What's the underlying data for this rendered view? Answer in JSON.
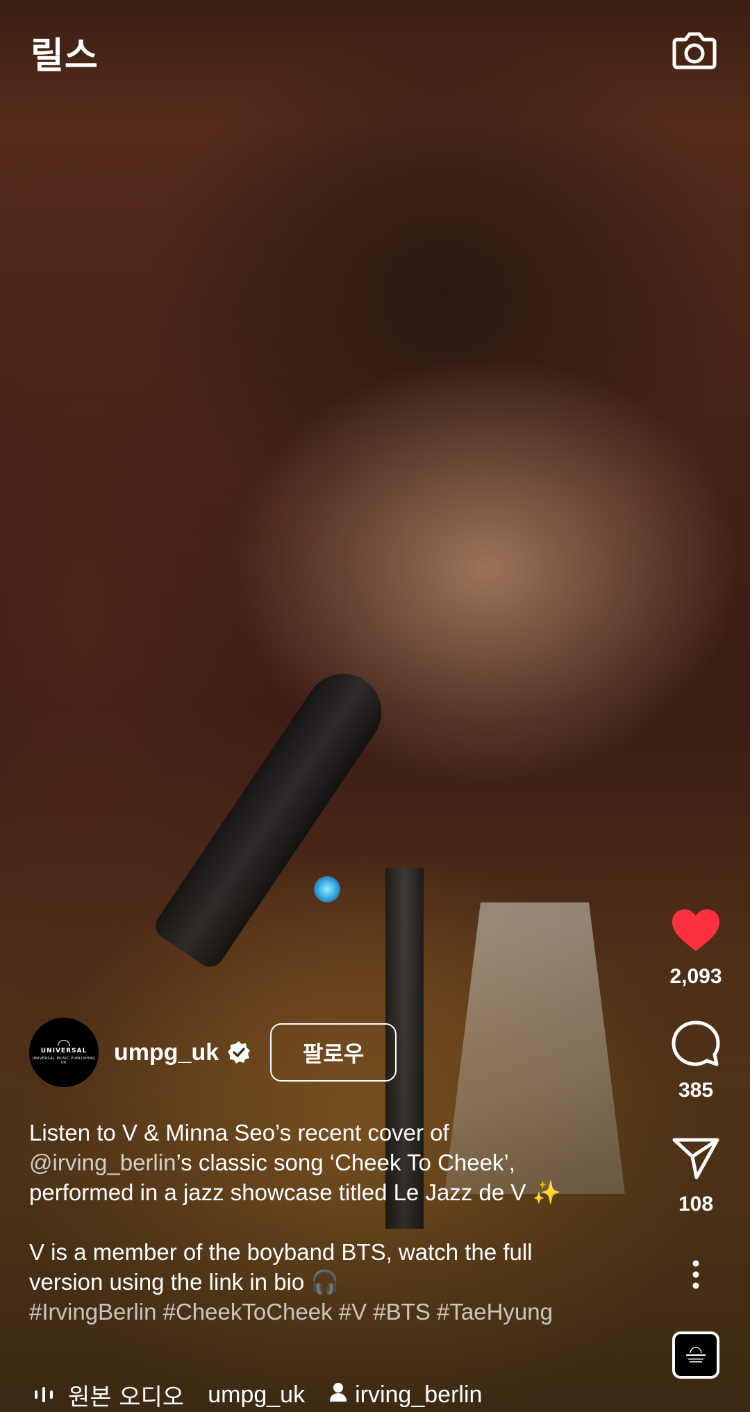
{
  "header": {
    "title": "릴스",
    "camera_icon": "camera-icon"
  },
  "actions": {
    "likes": {
      "icon": "heart-filled-icon",
      "count": "2,093",
      "color": "#ff3040",
      "liked": true
    },
    "comments": {
      "icon": "comment-bubble-icon",
      "count": "385"
    },
    "shares": {
      "icon": "paper-plane-icon",
      "count": "108"
    },
    "more_icon": "more-vertical-icon",
    "audio_thumb_icon": "audio-cover-thumbnail"
  },
  "author": {
    "username": "umpg_uk",
    "verified": true,
    "avatar_text_main": "UNIVERSAL",
    "avatar_text_sub": "UNIVERSAL MUSIC PUBLISHING UK",
    "follow_label": "팔로우"
  },
  "caption": {
    "line1": "Listen to V & Minna Seo’s recent cover of",
    "mention": "@irving_berlin",
    "line2_rest": "’s classic song ‘Cheek To Cheek’,",
    "line3": "performed in a jazz showcase titled Le Jazz de V ✨",
    "line4": "V is a member of the boyband BTS, watch the full",
    "line5": "version using the link in bio 🎧",
    "hashtags": [
      "#IrvingBerlin",
      "#CheekToCheek",
      "#V",
      "#BTS",
      "#TaeHyung"
    ]
  },
  "audio": {
    "label": "원본 오디오",
    "creator": "umpg_uk",
    "tagged_user": "irving_berlin"
  },
  "colors": {
    "text": "#ffffff",
    "like_red": "#ff3040"
  }
}
